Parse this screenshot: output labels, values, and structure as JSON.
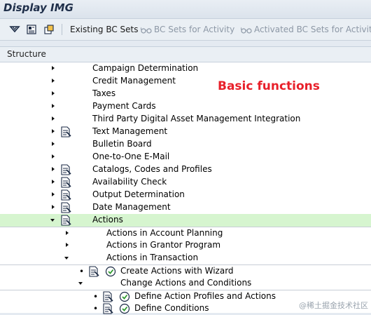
{
  "window": {
    "title": "Display IMG"
  },
  "toolbar": {
    "buttons": [
      {
        "label": "Existing BC Sets",
        "enabled": true,
        "icon": "bc-set-icon"
      },
      {
        "label": "BC Sets for Activity",
        "enabled": false,
        "icon": "glasses-icon"
      },
      {
        "label": "Activated BC Sets for Activity",
        "enabled": false,
        "icon": "glasses-icon"
      }
    ]
  },
  "tree": {
    "header": "Structure",
    "rows": [
      {
        "label": "Campaign Determination",
        "expanded": false,
        "doc": false,
        "exec": false
      },
      {
        "label": "Credit Management",
        "expanded": false,
        "doc": false,
        "exec": false
      },
      {
        "label": "Taxes",
        "expanded": false,
        "doc": false,
        "exec": false
      },
      {
        "label": "Payment Cards",
        "expanded": false,
        "doc": false,
        "exec": false
      },
      {
        "label": "Third Party Digital Asset Management Integration",
        "expanded": false,
        "doc": false,
        "exec": false
      },
      {
        "label": "Text Management",
        "expanded": false,
        "doc": true,
        "exec": false
      },
      {
        "label": "Bulletin Board",
        "expanded": false,
        "doc": false,
        "exec": false
      },
      {
        "label": "One-to-One E-Mail",
        "expanded": false,
        "doc": false,
        "exec": false
      },
      {
        "label": "Catalogs, Codes and Profiles",
        "expanded": false,
        "doc": true,
        "exec": false
      },
      {
        "label": "Availability Check",
        "expanded": false,
        "doc": true,
        "exec": false
      },
      {
        "label": "Output Determination",
        "expanded": false,
        "doc": true,
        "exec": false
      },
      {
        "label": "Date Management",
        "expanded": false,
        "doc": true,
        "exec": false
      },
      {
        "label": "Actions",
        "expanded": true,
        "doc": true,
        "exec": false,
        "selected": true
      },
      {
        "label": "Actions in Account Planning",
        "expanded": false,
        "doc": false,
        "exec": false,
        "sep": true
      },
      {
        "label": "Actions in Grantor Program",
        "expanded": false,
        "doc": false,
        "exec": false
      },
      {
        "label": "Actions in Transaction",
        "expanded": true,
        "doc": false,
        "exec": false
      },
      {
        "label": "Create Actions with Wizard",
        "leaf": true,
        "doc": true,
        "exec": true,
        "sep": true
      },
      {
        "label": "Change Actions and Conditions",
        "expanded": true,
        "doc": false,
        "exec": false
      },
      {
        "label": "Define Action Profiles and Actions",
        "leaf": true,
        "doc": true,
        "exec": true,
        "sep": true
      },
      {
        "label": "Define Conditions",
        "leaf": true,
        "doc": true,
        "exec": true
      }
    ]
  },
  "annotation": "Basic functions",
  "watermark": "@稀土掘金技术社区",
  "colors": {
    "annotation": "#e8202a",
    "selected_row": "#d6f5cf"
  }
}
